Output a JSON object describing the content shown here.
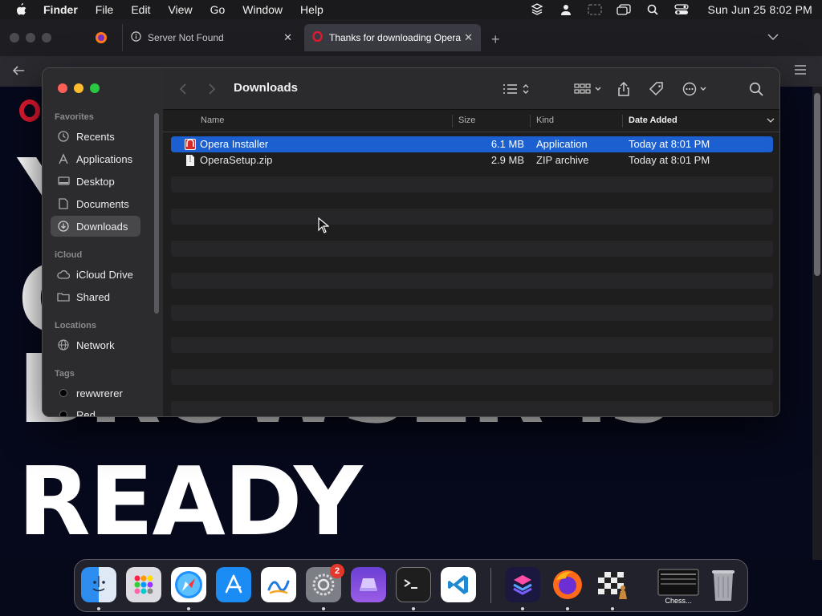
{
  "menubar": {
    "app_name": "Finder",
    "menus": [
      "File",
      "Edit",
      "View",
      "Go",
      "Window",
      "Help"
    ],
    "status_icons": [
      "stack-icon",
      "user-icon",
      "screen-mirror-icon",
      "windows-icon",
      "search-icon",
      "control-center-icon"
    ],
    "clock": "Sun Jun 25  8:02 PM"
  },
  "browser": {
    "tabs": [
      {
        "title": "Server Not Found",
        "icon": "info-icon",
        "active": false
      },
      {
        "title": "Thanks for downloading Opera",
        "icon": "opera-icon",
        "active": true
      }
    ],
    "hero_lines": [
      "Y",
      "C",
      "BROWSER IS",
      "READY"
    ],
    "accent": "#e3192f"
  },
  "finder": {
    "title": "Downloads",
    "sidebar": {
      "favorites_label": "Favorites",
      "favorites": [
        {
          "label": "Recents",
          "icon": "clock-icon"
        },
        {
          "label": "Applications",
          "icon": "applications-icon"
        },
        {
          "label": "Desktop",
          "icon": "desktop-icon"
        },
        {
          "label": "Documents",
          "icon": "document-icon"
        },
        {
          "label": "Downloads",
          "icon": "download-icon",
          "selected": true
        }
      ],
      "icloud_label": "iCloud",
      "icloud": [
        {
          "label": "iCloud Drive",
          "icon": "cloud-icon"
        },
        {
          "label": "Shared",
          "icon": "shared-folder-icon"
        }
      ],
      "locations_label": "Locations",
      "locations": [
        {
          "label": "Network",
          "icon": "globe-icon"
        }
      ],
      "tags_label": "Tags",
      "tags": [
        {
          "label": "rewwrerer",
          "color": "#000000"
        },
        {
          "label": "Red",
          "color": "#000000"
        }
      ]
    },
    "columns": {
      "name": "Name",
      "size": "Size",
      "kind": "Kind",
      "date_added": "Date Added"
    },
    "files": [
      {
        "name": "Opera Installer",
        "size": "6.1 MB",
        "kind": "Application",
        "date_added": "Today at 8:01 PM",
        "selected": true,
        "icon": "installer-icon"
      },
      {
        "name": "OperaSetup.zip",
        "size": "2.9 MB",
        "kind": "ZIP archive",
        "date_added": "Today at 8:01 PM",
        "selected": false,
        "icon": "zip-file-icon"
      }
    ],
    "selection_color": "#1b5fd1"
  },
  "dock": {
    "apps": [
      {
        "name": "finder-icon"
      },
      {
        "name": "launchpad-icon"
      },
      {
        "name": "safari-icon"
      },
      {
        "name": "app-store-icon"
      },
      {
        "name": "freeform-icon"
      },
      {
        "name": "system-settings-icon",
        "badge": "2"
      },
      {
        "name": "simulator-icon"
      },
      {
        "name": "terminal-icon"
      },
      {
        "name": "vscode-icon"
      },
      {
        "name": "shortcuts-icon"
      },
      {
        "name": "firefox-icon"
      },
      {
        "name": "chess-icon"
      }
    ],
    "minimized_label": "Chess..."
  }
}
